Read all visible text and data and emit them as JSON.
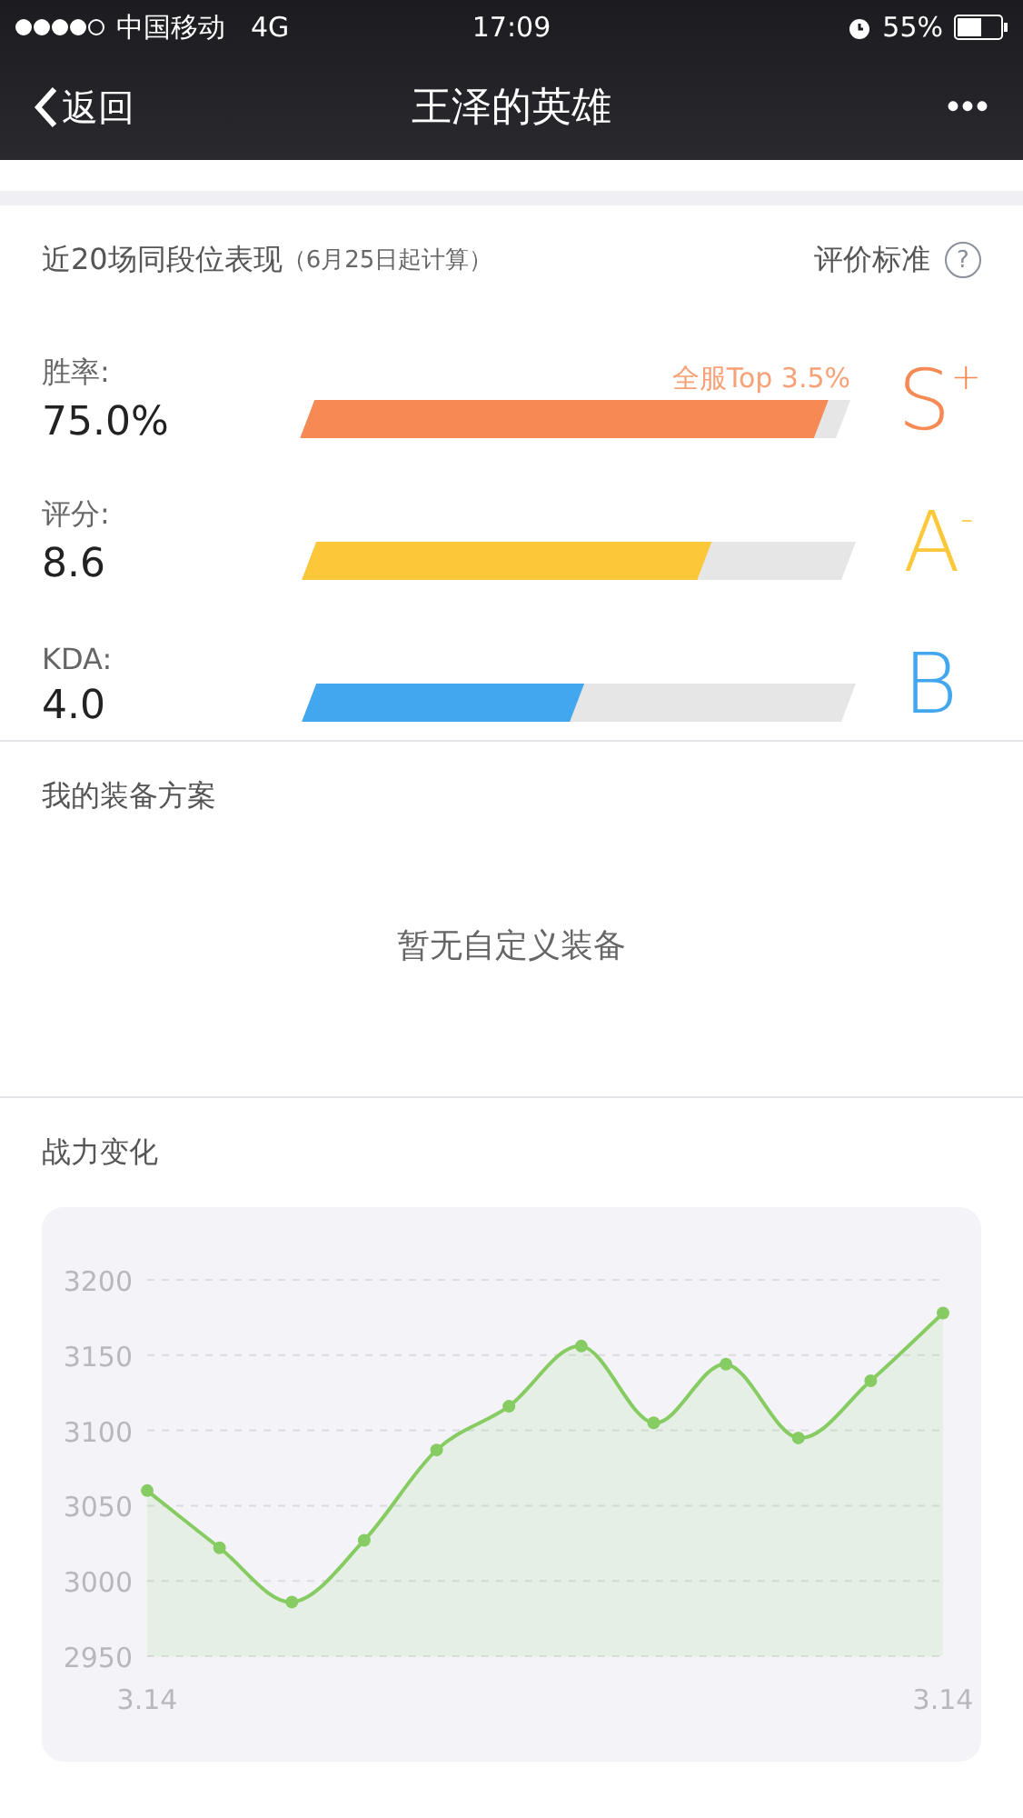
{
  "status_bar": {
    "carrier": "中国移动",
    "network": "4G",
    "time": "17:09",
    "battery": "55%"
  },
  "nav": {
    "back": "返回",
    "title": "王泽的英雄",
    "more": "•••"
  },
  "performance": {
    "title": "近20场同段位表现",
    "subtitle": "（6月25日起计算）",
    "criteria": "评价标准",
    "help": "?",
    "metrics": [
      {
        "label": "胜率:",
        "value": "75.0%",
        "level": 0.96,
        "color": "#f58a55",
        "note": "全服Top 3.5%",
        "grade": "S",
        "grade_mark": "+"
      },
      {
        "label": "评分:",
        "value": "8.6",
        "level": 0.74,
        "color": "#fcc83a",
        "grade": "A",
        "grade_mark": "-"
      },
      {
        "label": "KDA:",
        "value": "4.0",
        "level": 0.51,
        "color": "#42a7ef",
        "grade": "B"
      }
    ]
  },
  "equipment": {
    "title": "我的装备方案",
    "empty": "暂无自定义装备"
  },
  "power": {
    "title": "战力变化",
    "chart_data": {
      "type": "area",
      "grid": true,
      "categories": [
        "3.14",
        null,
        null,
        null,
        null,
        null,
        null,
        null,
        null,
        null,
        null,
        "3.14"
      ],
      "ylim": [
        2950,
        3200
      ],
      "yticks": [
        2950,
        3000,
        3050,
        3100,
        3150,
        3200
      ],
      "series": [
        {
          "color": "#86cc62",
          "values": [
            3060,
            3022,
            2986,
            3027,
            3087,
            3116,
            3156,
            3105,
            3144,
            3095,
            3133,
            3178
          ]
        }
      ]
    }
  }
}
